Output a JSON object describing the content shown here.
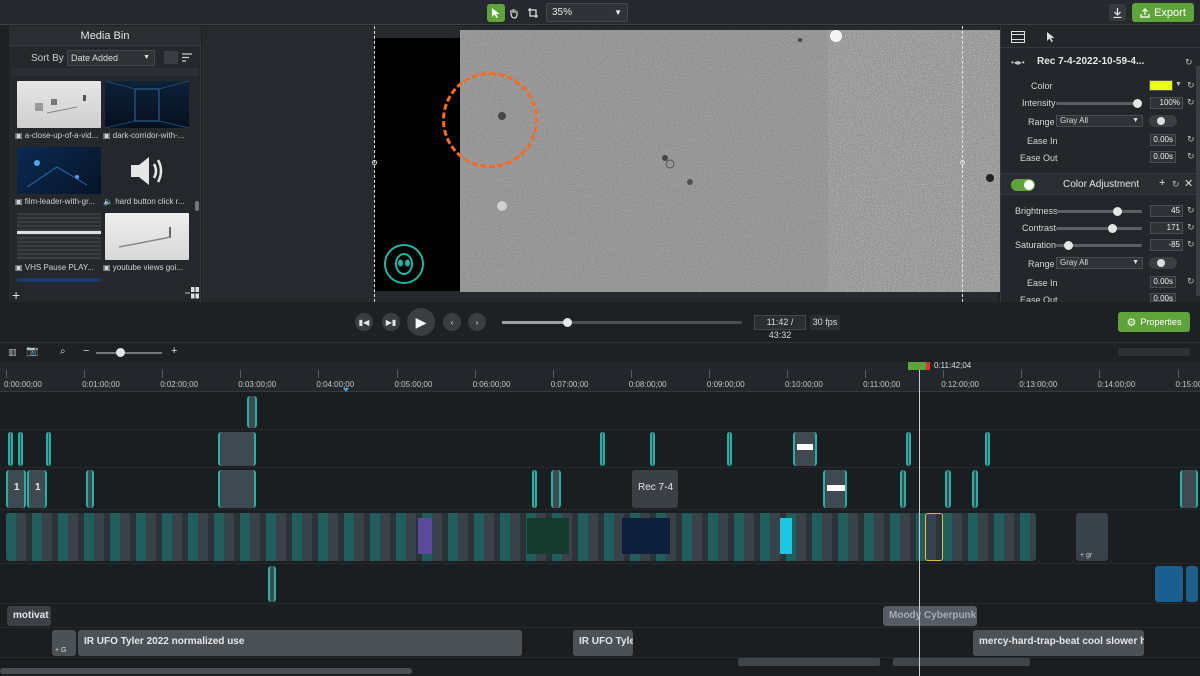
{
  "topbar": {
    "zoom": "35%",
    "export_label": "Export",
    "tools": [
      "select-tool",
      "pan-tool",
      "crop-tool"
    ]
  },
  "media_bin": {
    "title": "Media Bin",
    "sort_label": "Sort By",
    "sort_value": "Date Added",
    "items": [
      {
        "label": "a-close-up-of-a-vid..."
      },
      {
        "label": "dark-corridor-with-..."
      },
      {
        "label": "film-leader-with-gr..."
      },
      {
        "label": "hard button click r..."
      },
      {
        "label": "VHS Pause PLAY..."
      },
      {
        "label": "youtube views goi..."
      }
    ]
  },
  "properties": {
    "clip_title": "Rec 7-4-2022-10-59-4...",
    "color_label": "Color",
    "color_value": "#e8ff14",
    "intensity_label": "Intensity",
    "intensity_value": "100%",
    "intensity_level": 1.0,
    "range_label": "Range",
    "range_value": "Gray All",
    "ease_in_label": "Ease In",
    "ease_in_value": "0.00s",
    "ease_out_label": "Ease Out",
    "ease_out_value": "0.00s",
    "section_title": "Color Adjustment",
    "brightness_label": "Brightness",
    "brightness_value": "45",
    "contrast_label": "Contrast",
    "contrast_value": "171",
    "saturation_label": "Saturation",
    "saturation_value": "-85",
    "range2_label": "Range",
    "range2_value": "Gray All",
    "ease_in2_label": "Ease In",
    "ease_in2_value": "0.00s",
    "ease_out2_label": "Ease Out",
    "ease_out2_value": "0.00s"
  },
  "transport": {
    "timecode": "11:42 / 43:32",
    "fps": "30 fps",
    "progress": 0.27,
    "properties_label": "Properties"
  },
  "ruler": {
    "playhead_time": "0:11:42;04",
    "ticks": [
      "0:00:00;00",
      "0:01:00;00",
      "0:02:00;00",
      "0:03:00;00",
      "0:04:00;00",
      "0:05:00;00",
      "0:06:00;00",
      "0:07:00;00",
      "0:08:00;00",
      "0:09:00;00",
      "0:10:00;00",
      "0:11:00;00",
      "0:12:00;00",
      "0:13:00;00",
      "0:14:00;00",
      "0:15:00"
    ]
  },
  "timeline_clips": {
    "rec_short": "Rec 7-4",
    "one_a": "1",
    "one_b": "1",
    "motivat": "motivat",
    "moody": "Moody Cyberpunk",
    "ufo_long": "IR UFO Tyler 2022 normalized use",
    "ufo_short": "IR UFO Tyle",
    "mercy": "mercy-hard-trap-beat cool slower ha",
    "plus_gr": "+ gr",
    "plus_g": "+ G"
  },
  "colors": {
    "accent": "#5fa43a",
    "clip_edge": "#22b3a6",
    "focus_ring": "#ff6a1f"
  }
}
